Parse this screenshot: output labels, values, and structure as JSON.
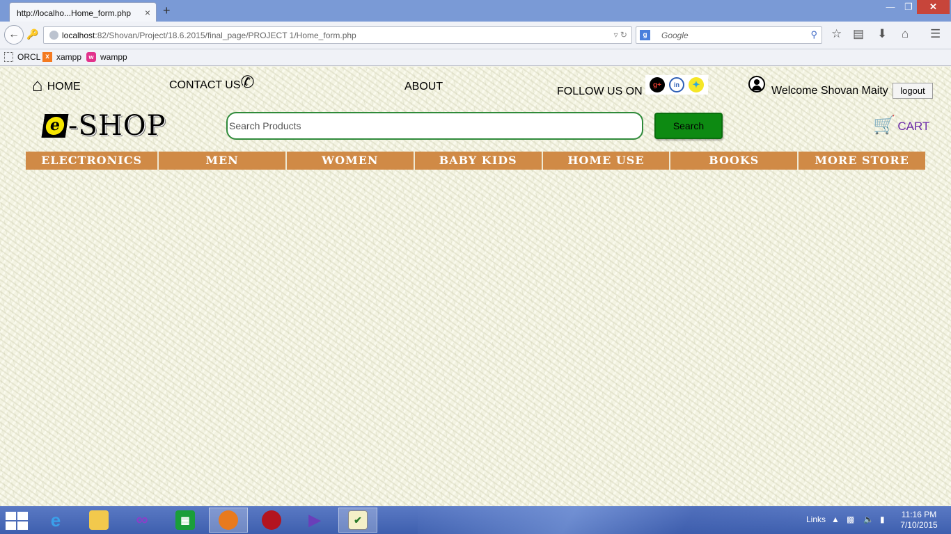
{
  "browser": {
    "tab_title": "http://localho...Home_form.php",
    "tab_close": "×",
    "new_tab": "+",
    "url_host": "localhost",
    "url_path": ":82/Shovan/Project/18.6.2015/final_page/PROJECT 1/Home_form.php",
    "search_engine_badge": "g",
    "search_placeholder": "Google",
    "bookmarks": [
      {
        "label": "ORCL",
        "icon": "page-icon"
      },
      {
        "label": "xampp",
        "icon": "xampp-icon"
      },
      {
        "label": "wampp",
        "icon": "wampp-icon"
      }
    ],
    "toolbar_icons": [
      "star-icon",
      "reader-icon",
      "download-icon",
      "home-icon",
      "menu-icon"
    ]
  },
  "header": {
    "home": "HOME",
    "contact": "CONTACT US",
    "about": "ABOUT",
    "follow": "FOLLOW US ON",
    "social": [
      "google-plus-icon",
      "linkedin-icon",
      "twitter-icon"
    ],
    "welcome": "Welcome Shovan Maity",
    "logout": "logout"
  },
  "logo": {
    "mark": "e",
    "text": "-SHOP"
  },
  "search": {
    "placeholder": "Search Products",
    "button": "Search"
  },
  "cart": {
    "label": "CART"
  },
  "categories": [
    "ELECTRONICS",
    "MEN",
    "WOMEN",
    "BABY KIDS",
    "HOME USE",
    "BOOKS",
    "MORE STORE"
  ],
  "colors": {
    "category_bg": "#d08a46",
    "search_border": "#2f8a3a",
    "search_button": "#0d8a12",
    "cart_label": "#6c2aa8",
    "logo_accent": "#f6e600"
  },
  "taskbar": {
    "apps": [
      "internet-explorer",
      "file-explorer",
      "visual-studio",
      "store",
      "firefox",
      "app-red",
      "visual-studio-2",
      "notepad"
    ],
    "links": "Links",
    "time": "11:16 PM",
    "date": "7/10/2015"
  }
}
